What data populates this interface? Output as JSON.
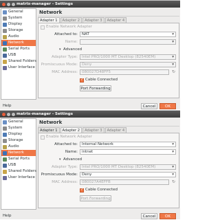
{
  "windows": [
    {
      "title": "matrix-manager - Settings",
      "sidebar": [
        {
          "label": "General",
          "color": "#6a8fc4"
        },
        {
          "label": "System",
          "color": "#8a8a8a"
        },
        {
          "label": "Display",
          "color": "#4e7bb5"
        },
        {
          "label": "Storage",
          "color": "#8d8d8d"
        },
        {
          "label": "Audio",
          "color": "#b7a14a"
        },
        {
          "label": "Network",
          "color": "#3b73b8"
        },
        {
          "label": "Serial Ports",
          "color": "#5a8c5a"
        },
        {
          "label": "USB",
          "color": "#4a6a9a"
        },
        {
          "label": "Shared Folders",
          "color": "#c9a54a"
        },
        {
          "label": "User Interface",
          "color": "#6a6a9a"
        }
      ],
      "active_sidebar": "Network",
      "heading": "Network",
      "tabs": [
        "Adapter 1",
        "Adapter 2",
        "Adapter 3",
        "Adapter 4"
      ],
      "active_tab": "Adapter 1",
      "enable_label": "Enable Network Adapter",
      "attached_label": "Attached to:",
      "attached_value": "NAT",
      "name_label": "Name:",
      "name_value": "",
      "advanced_label": "Advanced",
      "adapter_type_label": "Adapter Type:",
      "adapter_type_value": "Intel PRO/1000 MT Desktop (82540EM)",
      "promiscuous_label": "Promiscuous Mode:",
      "promiscuous_value": "Deny",
      "mac_label": "MAC Address:",
      "mac_value": "080027D48FF5",
      "cable_label": "Cable Connected",
      "port_forwarding_label": "Port Forwarding",
      "help_label": "Help",
      "cancel_label": "Cancel",
      "ok_label": "OK"
    },
    {
      "title": "matrix-manager - Settings",
      "heading": "Network",
      "tabs": [
        "Adapter 1",
        "Adapter 2",
        "Adapter 3",
        "Adapter 4"
      ],
      "active_tab": "Adapter 2",
      "enable_label": "Enable Network Adapter",
      "attached_label": "Attached to:",
      "attached_value": "Internal Network",
      "name_label": "Name:",
      "name_value": "intnet",
      "advanced_label": "Advanced",
      "adapter_type_label": "Adapter Type:",
      "adapter_type_value": "Intel PRO/1000 MT Desktop (82540EM)",
      "promiscuous_label": "Promiscuous Mode:",
      "promiscuous_value": "Deny",
      "mac_label": "MAC Address:",
      "mac_value": "080027A4EFFB",
      "cable_label": "Cable Connected",
      "port_forwarding_label": "Port Forwarding",
      "help_label": "Help",
      "cancel_label": "Cancel",
      "ok_label": "OK"
    }
  ],
  "colors": {
    "accent": "#f07746",
    "titlebar": "#3c3c3c"
  }
}
